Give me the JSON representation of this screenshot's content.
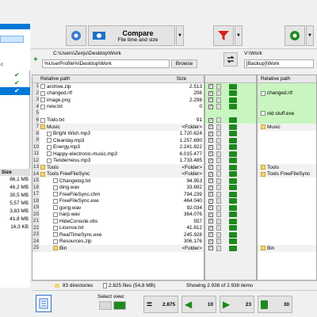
{
  "toolbar": {
    "compare_label": "Compare",
    "compare_sub": "File time and size",
    "compare_arrow": "▼"
  },
  "left_panel": {
    "path_history": "C:\\Users\\Zenju\\Desktop\\Work",
    "path_input": "%UserProfile%\\Desktop\\Work",
    "browse": "Browse",
    "plus": "+"
  },
  "right_panel": {
    "path_history": "V:\\Work",
    "path_input": "[Backup]\\Work"
  },
  "sidebar": {
    "top_label": "c",
    "size_header": "Size",
    "sizes": [
      "86,1 MB",
      "46,2 MB",
      "30,5 MB",
      "5,57 MB",
      "3,83 MB",
      "41,8 MB",
      "16,3 KB"
    ]
  },
  "grid": {
    "col_relative_path": "Relative path",
    "col_size": "Size",
    "col_relative_path_right": "Relative path"
  },
  "left_rows": [
    {
      "n": "1",
      "name": "archive.zip",
      "size": "2.513",
      "type": "file",
      "indent": 0
    },
    {
      "n": "2",
      "name": "changed.rtf",
      "size": "208",
      "type": "file",
      "indent": 0
    },
    {
      "n": "3",
      "name": "image.png",
      "size": "2.298",
      "type": "file",
      "indent": 0
    },
    {
      "n": "4",
      "name": "new.txt",
      "size": "0",
      "type": "file",
      "indent": 0
    },
    {
      "n": "5",
      "name": "",
      "size": "",
      "type": "empty",
      "indent": 0
    },
    {
      "n": "6",
      "name": "Todo.txt",
      "size": "91",
      "type": "file",
      "indent": 0
    },
    {
      "n": "7",
      "name": "Music",
      "size": "<Folder>",
      "type": "folder",
      "indent": 0
    },
    {
      "n": "8",
      "name": "Bright Wish.mp3",
      "size": "1.720.624",
      "type": "file",
      "indent": 2
    },
    {
      "n": "9",
      "name": "Clearday.mp3",
      "size": "1.257.690",
      "type": "file",
      "indent": 2
    },
    {
      "n": "10",
      "name": "Energy.mp3",
      "size": "2.241.822",
      "type": "file",
      "indent": 2
    },
    {
      "n": "11",
      "name": "Happy-electronic-music.mp3",
      "size": "6.015.477",
      "type": "file",
      "indent": 2
    },
    {
      "n": "12",
      "name": "Tenderness.mp3",
      "size": "1.733.485",
      "type": "file",
      "indent": 2
    },
    {
      "n": "13",
      "name": "Tools",
      "size": "<Folder>",
      "type": "folder",
      "indent": 0
    },
    {
      "n": "14",
      "name": "Tools  FreeFileSync",
      "size": "<Folder>",
      "type": "folder2",
      "indent": 0
    },
    {
      "n": "15",
      "name": "Changelog.txt",
      "size": "94.953",
      "type": "file",
      "indent": 4
    },
    {
      "n": "16",
      "name": "ding.wav",
      "size": "33.692",
      "type": "file",
      "indent": 4
    },
    {
      "n": "17",
      "name": "FreeFileSync.chm",
      "size": "794.239",
      "type": "file",
      "indent": 4
    },
    {
      "n": "18",
      "name": "FreeFileSync.exe",
      "size": "464.040",
      "type": "file",
      "indent": 4
    },
    {
      "n": "19",
      "name": "gong.wav",
      "size": "92.034",
      "type": "file",
      "indent": 4
    },
    {
      "n": "20",
      "name": "harp.wav",
      "size": "364.076",
      "type": "file",
      "indent": 4
    },
    {
      "n": "21",
      "name": "HideConsole.vbs",
      "size": "557",
      "type": "file",
      "indent": 4
    },
    {
      "n": "22",
      "name": "License.txt",
      "size": "41.812",
      "type": "file",
      "indent": 4
    },
    {
      "n": "23",
      "name": "RealTimeSync.exe",
      "size": "245.928",
      "type": "file",
      "indent": 4
    },
    {
      "n": "24",
      "name": "Resources.zip",
      "size": "306.176",
      "type": "file",
      "indent": 4
    },
    {
      "n": "25",
      "name": "Bin",
      "size": "<Folder>",
      "type": "folder",
      "indent": 4
    }
  ],
  "right_rows": [
    {
      "n": "1",
      "name": "",
      "type": "empty"
    },
    {
      "n": "2",
      "name": "changed.rtf",
      "type": "file"
    },
    {
      "n": "3",
      "name": "",
      "type": "empty"
    },
    {
      "n": "4",
      "name": "",
      "type": "empty"
    },
    {
      "n": "5",
      "name": "old stuff.exe",
      "type": "file"
    },
    {
      "n": "6",
      "name": "",
      "type": "empty"
    },
    {
      "n": "7",
      "name": "Music",
      "type": "folder"
    },
    {
      "n": "8",
      "name": "",
      "type": "empty"
    },
    {
      "n": "9",
      "name": "",
      "type": "empty"
    },
    {
      "n": "10",
      "name": "",
      "type": "empty"
    },
    {
      "n": "11",
      "name": "",
      "type": "empty"
    },
    {
      "n": "12",
      "name": "",
      "type": "empty"
    },
    {
      "n": "13",
      "name": "Tools",
      "type": "folder"
    },
    {
      "n": "14",
      "name": "Tools  FreeFileSync",
      "type": "folder2"
    },
    {
      "n": "15",
      "name": "",
      "type": "empty"
    },
    {
      "n": "16",
      "name": "",
      "type": "empty"
    },
    {
      "n": "17",
      "name": "",
      "type": "empty"
    },
    {
      "n": "18",
      "name": "",
      "type": "empty"
    },
    {
      "n": "19",
      "name": "",
      "type": "empty"
    },
    {
      "n": "20",
      "name": "",
      "type": "empty"
    },
    {
      "n": "21",
      "name": "",
      "type": "empty"
    },
    {
      "n": "22",
      "name": "",
      "type": "empty"
    },
    {
      "n": "23",
      "name": "",
      "type": "empty"
    },
    {
      "n": "24",
      "name": "",
      "type": "empty"
    },
    {
      "n": "25",
      "name": "Bin",
      "type": "folder"
    }
  ],
  "status": {
    "directories": "83 directories",
    "files": "2.825 files (54,8 MB)",
    "showing": "Showing 2.938 of 2.938 items",
    "bin": "Bin"
  },
  "bottom": {
    "select_view": "Select view:",
    "count_equal": "2.875",
    "count_left": "10",
    "count_right": "23",
    "count_delete": "30"
  },
  "colors": {
    "accent": "#0078d7",
    "green": "#1e8a1e",
    "row_green": "#c9f5c0",
    "selected": "#3399ff"
  }
}
